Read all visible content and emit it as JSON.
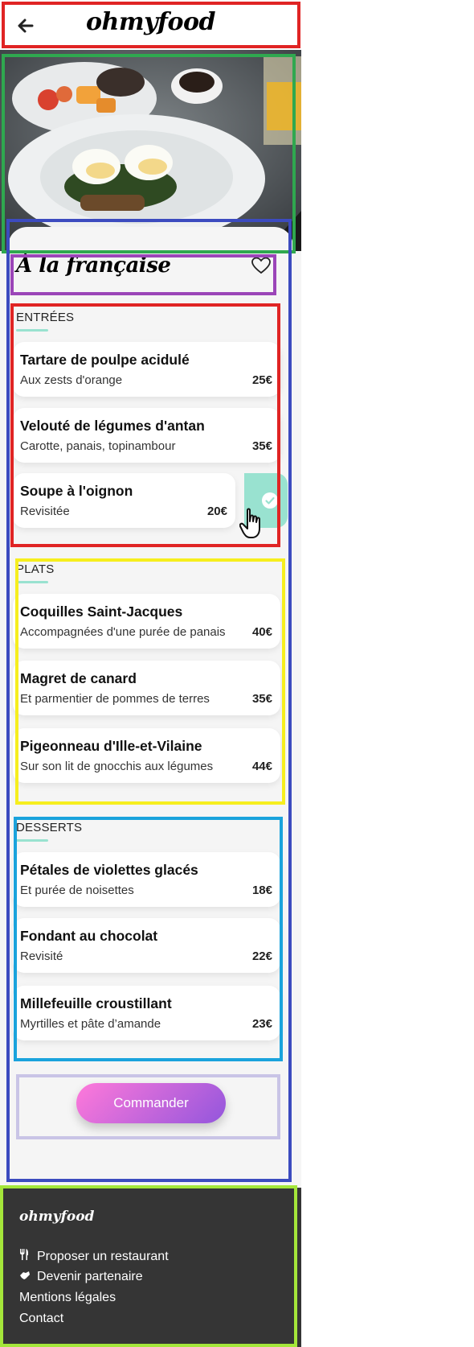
{
  "header": {
    "brand": "ohmyfood"
  },
  "restaurant": {
    "name": "À la française"
  },
  "sections": [
    {
      "label": "ENTRÉES",
      "dishes": [
        {
          "name": "Tartare de poulpe acidulé",
          "desc": "Aux zests d'orange",
          "price": "25€"
        },
        {
          "name": "Velouté de légumes d'antan",
          "desc": "Carotte, panais, topinambour",
          "price": "35€"
        },
        {
          "name": "Soupe à l'oignon",
          "desc": "Revisitée",
          "price": "20€",
          "selected": true
        }
      ]
    },
    {
      "label": "PLATS",
      "dishes": [
        {
          "name": "Coquilles Saint-Jacques",
          "desc": "Accompagnées d'une purée de panais",
          "price": "40€"
        },
        {
          "name": "Magret de canard",
          "desc": "Et parmentier de pommes de terres",
          "price": "35€"
        },
        {
          "name": "Pigeonneau d'Ille-et-Vilaine",
          "desc": "Sur son lit de gnocchis aux légumes",
          "price": "44€"
        }
      ]
    },
    {
      "label": "DESSERTS",
      "dishes": [
        {
          "name": "Pétales de violettes glacés",
          "desc": "Et purée de noisettes",
          "price": "18€"
        },
        {
          "name": "Fondant au chocolat",
          "desc": "Revisité",
          "price": "22€"
        },
        {
          "name": "Millefeuille croustillant",
          "desc": "Myrtilles et pâte d’amande",
          "price": "23€"
        }
      ]
    }
  ],
  "order_button": "Commander",
  "footer": {
    "brand": "ohmyfood",
    "links": [
      {
        "label": "Proposer un restaurant",
        "icon": "utensils-icon"
      },
      {
        "label": "Devenir partenaire",
        "icon": "handshake-icon"
      },
      {
        "label": "Mentions légales"
      },
      {
        "label": "Contact"
      }
    ]
  },
  "colors": {
    "accent": "#99e2d0",
    "button_gradient_start": "#ff79da",
    "button_gradient_end": "#9356dc",
    "footer_bg": "#353535",
    "page_bg": "#f5f5f5"
  }
}
